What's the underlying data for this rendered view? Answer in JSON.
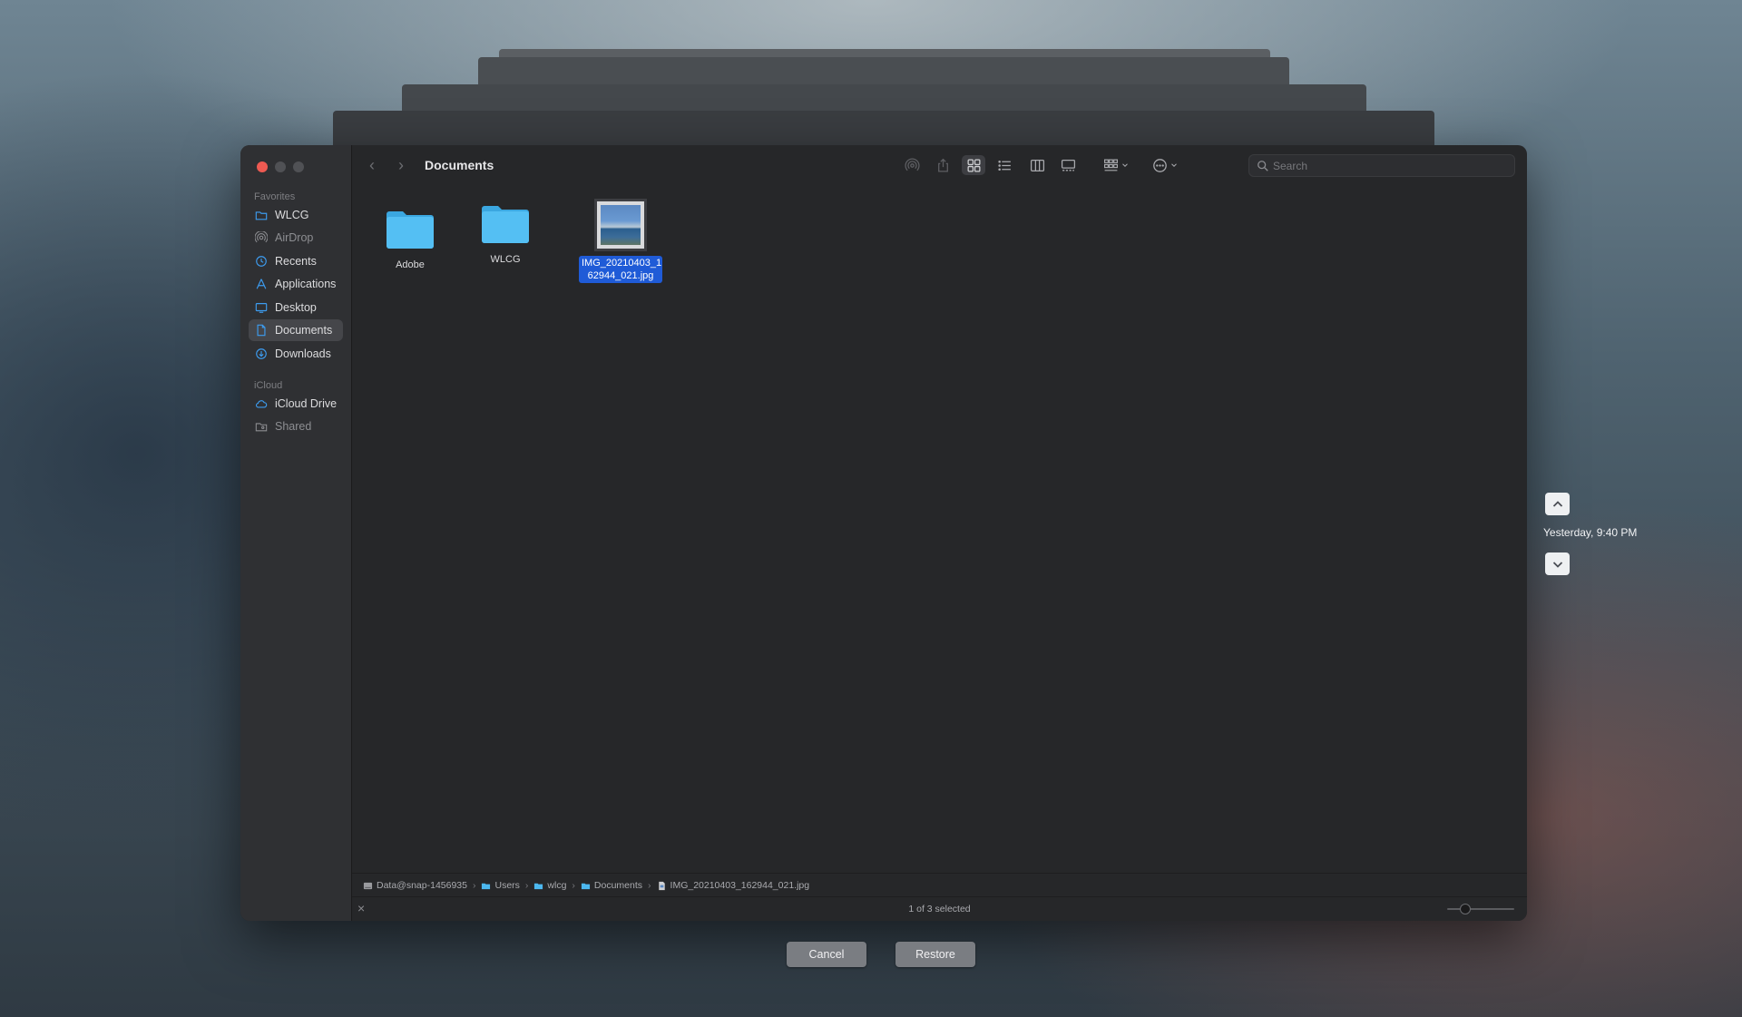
{
  "sidebar": {
    "favorites_heading": "Favorites",
    "icloud_heading": "iCloud",
    "favorites": [
      {
        "label": "WLCG",
        "icon": "folder-icon"
      },
      {
        "label": "AirDrop",
        "icon": "airdrop-icon"
      },
      {
        "label": "Recents",
        "icon": "clock-icon"
      },
      {
        "label": "Applications",
        "icon": "applications-icon"
      },
      {
        "label": "Desktop",
        "icon": "desktop-icon"
      },
      {
        "label": "Documents",
        "icon": "document-icon"
      },
      {
        "label": "Downloads",
        "icon": "download-icon"
      }
    ],
    "icloud": [
      {
        "label": "iCloud Drive",
        "icon": "cloud-icon"
      },
      {
        "label": "Shared",
        "icon": "shared-folder-icon"
      }
    ],
    "selected": "Documents"
  },
  "toolbar": {
    "title": "Documents",
    "search_placeholder": "Search",
    "active_view": "icon-view"
  },
  "files": [
    {
      "name": "Adobe",
      "type": "folder"
    },
    {
      "name": "WLCG",
      "type": "folder"
    },
    {
      "name": "IMG_20210403_1\n62944_021.jpg",
      "type": "image",
      "selected": true
    }
  ],
  "pathbar": [
    {
      "label": "Data@snap-1456935",
      "icon": "disk-icon"
    },
    {
      "label": "Users",
      "icon": "folder-icon"
    },
    {
      "label": "wlcg",
      "icon": "folder-icon"
    },
    {
      "label": "Documents",
      "icon": "folder-icon"
    },
    {
      "label": "IMG_20210403_162944_021.jpg",
      "icon": "file-icon"
    }
  ],
  "status": {
    "text": "1 of 3 selected"
  },
  "dialog": {
    "cancel_label": "Cancel",
    "restore_label": "Restore"
  },
  "timemachine": {
    "timestamp": "Yesterday, 9:40 PM"
  },
  "colors": {
    "accent": "#1f5bd7",
    "folder": "#4cb8ef",
    "close": "#ee5a52"
  }
}
